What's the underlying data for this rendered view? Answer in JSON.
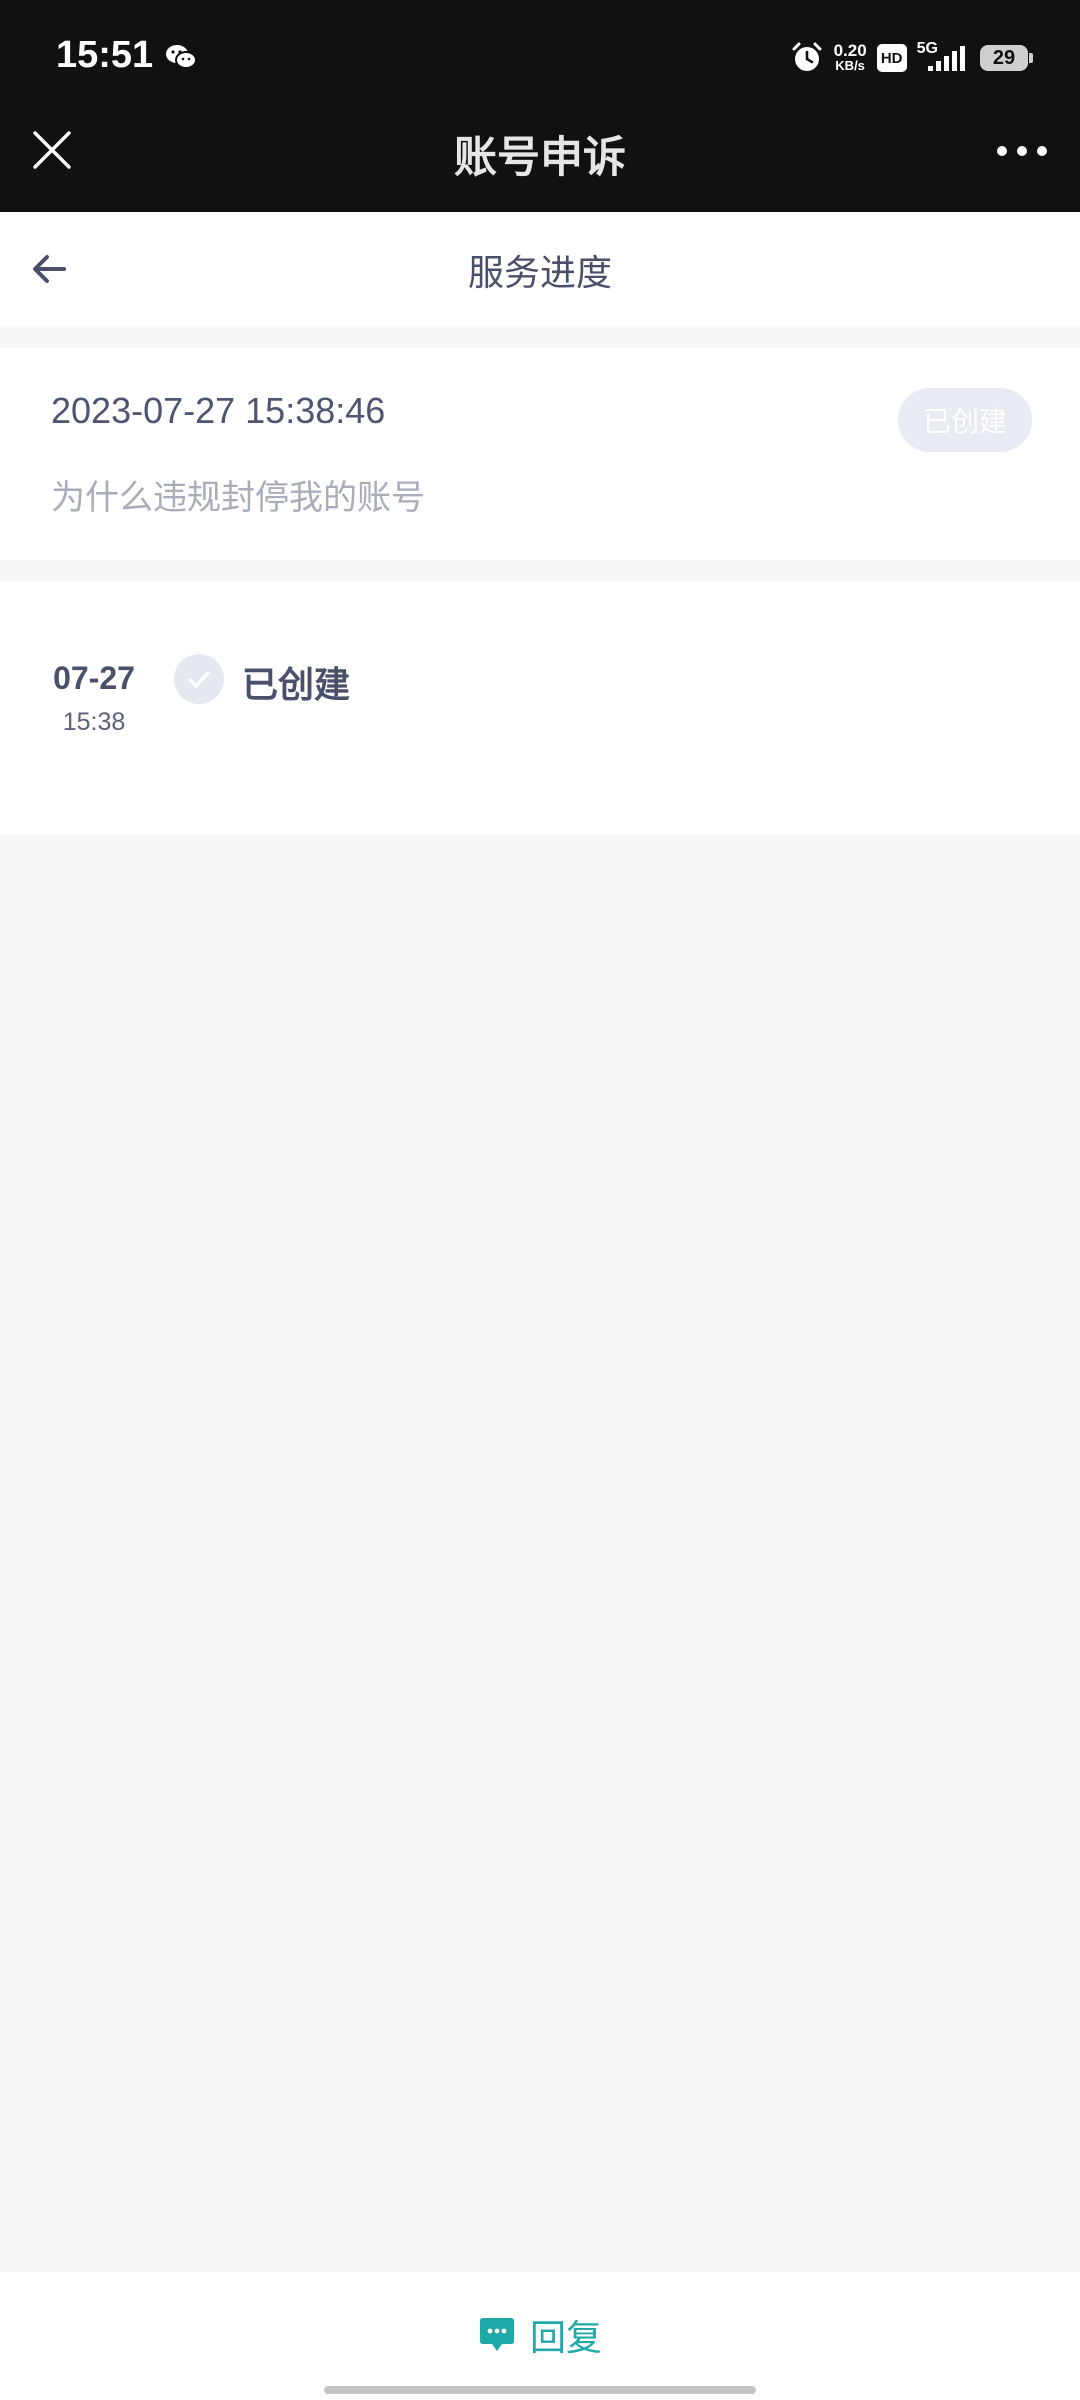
{
  "status_bar": {
    "time": "15:51",
    "net_speed_value": "0.20",
    "net_speed_unit": "KB/s",
    "hd": "HD",
    "network": "5G",
    "battery": "29"
  },
  "app_header": {
    "title": "账号申诉"
  },
  "page_header": {
    "title": "服务进度"
  },
  "ticket": {
    "datetime": "2023-07-27 15:38:46",
    "description": "为什么违规封停我的账号",
    "status": "已创建"
  },
  "timeline": [
    {
      "date": "07-27",
      "time": "15:38",
      "status": "已创建"
    }
  ],
  "bottom_bar": {
    "reply_label": "回复"
  },
  "colors": {
    "accent": "#1fa9a7",
    "text_primary": "#4a4f6a",
    "text_secondary": "#a8adb9",
    "background": "#f6f7f9",
    "header_dark": "#111112"
  },
  "icons": [
    "wechat-icon",
    "alarm-icon",
    "signal-icon",
    "close-icon",
    "more-icon",
    "back-icon",
    "check-icon",
    "chat-bubble-icon"
  ]
}
